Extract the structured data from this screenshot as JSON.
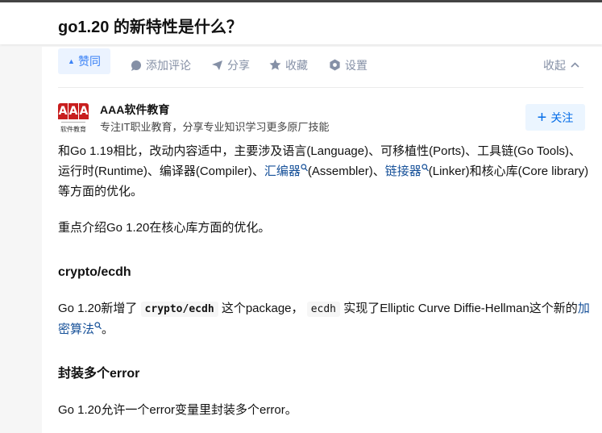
{
  "question": {
    "title": "go1.20 的新特性是什么？"
  },
  "actions": {
    "vote": "赞同",
    "comment": "添加评论",
    "share": "分享",
    "favorite": "收藏",
    "settings": "设置",
    "collapse": "收起"
  },
  "author": {
    "logo_text": "AAA",
    "logo_caption": "软件教育",
    "name": "AAA软件教育",
    "headline": "专注IT职业教育，分享专业知识学习更多原厂技能",
    "follow": "关注"
  },
  "article": {
    "p1_a": "和Go 1.19相比，改动内容适中，主要涉及语言(Language)、可移植性(Ports)、工具链(Go Tools)、运行时(Runtime)、编译器(Compiler)、",
    "p1_link1": "汇编器",
    "p1_b": "(Assembler)、",
    "p1_link2": "链接器",
    "p1_c": "(Linker)和核心库(Core library)等方面的优化。",
    "p2": "重点介绍Go 1.20在核心库方面的优化。",
    "h1": "crypto/ecdh",
    "p3_a": "Go 1.20新增了",
    "p3_code1": "crypto/ecdh",
    "p3_b": "这个package，",
    "p3_code2": "ecdh",
    "p3_c": "实现了Elliptic Curve Diffie-Hellman这个新的",
    "p3_link": "加密算法",
    "p3_d": "。",
    "h2": "封装多个error",
    "p4": "Go 1.20允许一个error变量里封装多个error。"
  },
  "colors": {
    "accent": "#056de8",
    "link": "#175199",
    "muted": "#8590a6",
    "logo_red": "#c81e1e"
  }
}
